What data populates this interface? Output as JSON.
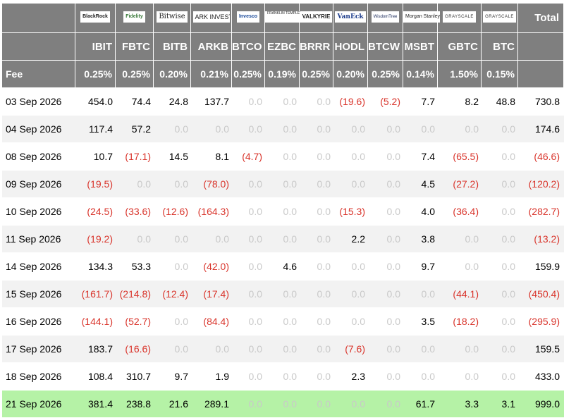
{
  "header": {
    "tickers": [
      "IBIT",
      "FBTC",
      "BITB",
      "ARKB",
      "BTCO",
      "EZBC",
      "BRRR",
      "HODL",
      "BTCW",
      "MSBT",
      "GBTC",
      "BTC"
    ],
    "total_label": "Total",
    "fee_label": "Fee",
    "fees": [
      "0.25%",
      "0.25%",
      "0.20%",
      "0.21%",
      "0.25%",
      "0.19%",
      "0.25%",
      "0.20%",
      "0.25%",
      "0.14%",
      "1.50%",
      "0.15%"
    ],
    "logos": [
      {
        "text": "BlackRock",
        "icon": "blackrock-logo"
      },
      {
        "text": "Fidelity",
        "icon": "fidelity-logo"
      },
      {
        "text": "Bitwise",
        "icon": "bitwise-logo"
      },
      {
        "text": "ARK INVEST",
        "icon": "ark-invest-logo"
      },
      {
        "text": "Invesco",
        "icon": "invesco-logo"
      },
      {
        "text": "FRANKLIN TEMPLETON",
        "icon": "franklin-templeton-logo"
      },
      {
        "text": "VALKYRIE",
        "icon": "valkyrie-logo"
      },
      {
        "text": "VanEck",
        "icon": "vaneck-logo"
      },
      {
        "text": "WisdomTree",
        "icon": "wisdomtree-logo"
      },
      {
        "text": "Morgan Stanley",
        "icon": "morgan-stanley-logo"
      },
      {
        "text": "GRAYSCALE",
        "icon": "grayscale-logo"
      },
      {
        "text": "GRAYSCALE",
        "icon": "grayscale-logo"
      }
    ]
  },
  "rows": [
    {
      "date": "03 Sep 2026",
      "values": [
        "454.0",
        "74.4",
        "24.8",
        "137.7",
        "0.0",
        "0.0",
        "0.0",
        "(19.6)",
        "(5.2)",
        "7.7",
        "8.2",
        "48.8"
      ],
      "total": "730.8"
    },
    {
      "date": "04 Sep 2026",
      "values": [
        "117.4",
        "57.2",
        "0.0",
        "0.0",
        "0.0",
        "0.0",
        "0.0",
        "0.0",
        "0.0",
        "0.0",
        "0.0",
        "0.0"
      ],
      "total": "174.6"
    },
    {
      "date": "08 Sep 2026",
      "values": [
        "10.7",
        "(17.1)",
        "14.5",
        "8.1",
        "(4.7)",
        "0.0",
        "0.0",
        "0.0",
        "0.0",
        "7.4",
        "(65.5)",
        "0.0"
      ],
      "total": "(46.6)"
    },
    {
      "date": "09 Sep 2026",
      "values": [
        "(19.5)",
        "0.0",
        "0.0",
        "(78.0)",
        "0.0",
        "0.0",
        "0.0",
        "0.0",
        "0.0",
        "4.5",
        "(27.2)",
        "0.0"
      ],
      "total": "(120.2)"
    },
    {
      "date": "10 Sep 2026",
      "values": [
        "(24.5)",
        "(33.6)",
        "(12.6)",
        "(164.3)",
        "0.0",
        "0.0",
        "0.0",
        "(15.3)",
        "0.0",
        "4.0",
        "(36.4)",
        "0.0"
      ],
      "total": "(282.7)"
    },
    {
      "date": "11 Sep 2026",
      "values": [
        "(19.2)",
        "0.0",
        "0.0",
        "0.0",
        "0.0",
        "0.0",
        "0.0",
        "2.2",
        "0.0",
        "3.8",
        "0.0",
        "0.0"
      ],
      "total": "(13.2)"
    },
    {
      "date": "14 Sep 2026",
      "values": [
        "134.3",
        "53.3",
        "0.0",
        "(42.0)",
        "0.0",
        "4.6",
        "0.0",
        "0.0",
        "0.0",
        "9.7",
        "0.0",
        "0.0"
      ],
      "total": "159.9"
    },
    {
      "date": "15 Sep 2026",
      "values": [
        "(161.7)",
        "(214.8)",
        "(12.4)",
        "(17.4)",
        "0.0",
        "0.0",
        "0.0",
        "0.0",
        "0.0",
        "0.0",
        "(44.1)",
        "0.0"
      ],
      "total": "(450.4)"
    },
    {
      "date": "16 Sep 2026",
      "values": [
        "(144.1)",
        "(52.7)",
        "0.0",
        "(84.4)",
        "0.0",
        "0.0",
        "0.0",
        "0.0",
        "0.0",
        "3.5",
        "(18.2)",
        "0.0"
      ],
      "total": "(295.9)"
    },
    {
      "date": "17 Sep 2026",
      "values": [
        "183.7",
        "(16.6)",
        "0.0",
        "0.0",
        "0.0",
        "0.0",
        "0.0",
        "(7.6)",
        "0.0",
        "0.0",
        "0.0",
        "0.0"
      ],
      "total": "159.5"
    },
    {
      "date": "18 Sep 2026",
      "values": [
        "108.4",
        "310.7",
        "9.7",
        "1.9",
        "0.0",
        "0.0",
        "0.0",
        "2.3",
        "0.0",
        "0.0",
        "0.0",
        "0.0"
      ],
      "total": "433.0"
    },
    {
      "date": "21 Sep 2026",
      "values": [
        "381.4",
        "238.8",
        "21.6",
        "289.1",
        "0.0",
        "0.0",
        "0.0",
        "0.0",
        "0.0",
        "61.7",
        "3.3",
        "3.1"
      ],
      "total": "999.0"
    }
  ],
  "colors": {
    "header_bg": "#7f7f7f",
    "row_alt_bg": "#f2f2f2",
    "highlight_row_bg": "#b5f2a6",
    "negative_text": "#d9342b",
    "zero_text": "#c9c9c9"
  }
}
